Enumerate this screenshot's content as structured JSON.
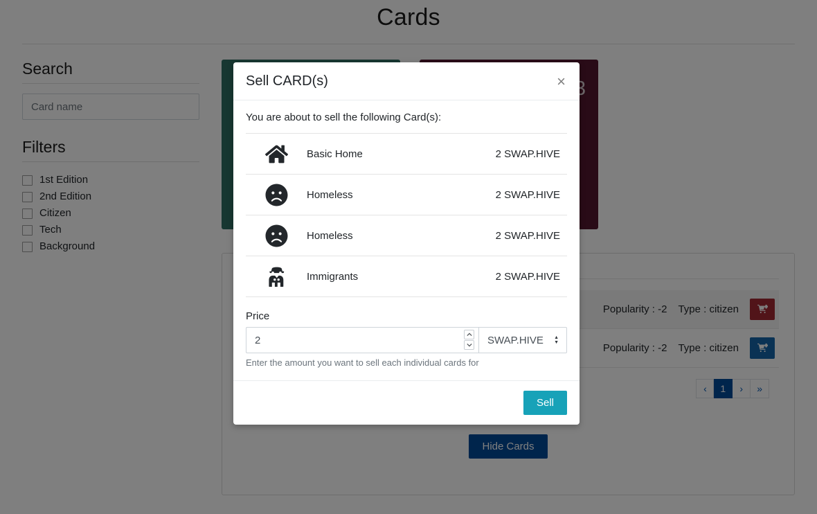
{
  "page": {
    "title": "Cards"
  },
  "sidebar": {
    "search_heading": "Search",
    "search_placeholder": "Card name",
    "search_value": "",
    "filters_heading": "Filters",
    "filters": [
      {
        "label": "1st Edition",
        "checked": false
      },
      {
        "label": "2nd Edition",
        "checked": false
      },
      {
        "label": "Citizen",
        "checked": false
      },
      {
        "label": "Tech",
        "checked": false
      },
      {
        "label": "Background",
        "checked": false
      }
    ]
  },
  "main": {
    "cards": [
      {
        "color": "#2e6e63",
        "corner_number": ""
      },
      {
        "color": "#52172f",
        "corner_number": "3"
      }
    ],
    "rows": [
      {
        "popularity_label": "Popularity : -2",
        "type_label": "Type : citizen",
        "cart_color": "#a32833",
        "cart_icon": "cart-plus-icon"
      },
      {
        "popularity_label": "Popularity : -2",
        "type_label": "Type : citizen",
        "cart_color": "#1565a8",
        "cart_icon": "cart-plus-icon"
      }
    ],
    "pagination": [
      {
        "label": "‹",
        "active": false,
        "name": "prev"
      },
      {
        "label": "1",
        "active": true,
        "name": "page-1"
      },
      {
        "label": "›",
        "active": false,
        "name": "next"
      },
      {
        "label": "»",
        "active": false,
        "name": "last"
      }
    ],
    "hide_cards_label": "Hide Cards"
  },
  "modal": {
    "title": "Sell CARD(s)",
    "close_label": "×",
    "lead": "You are about to sell the following Card(s):",
    "items": [
      {
        "icon": "home-icon",
        "name": "Basic Home",
        "price": "2 SWAP.HIVE"
      },
      {
        "icon": "frowning-face-icon",
        "name": "Homeless",
        "price": "2 SWAP.HIVE"
      },
      {
        "icon": "frowning-face-icon",
        "name": "Homeless",
        "price": "2 SWAP.HIVE"
      },
      {
        "icon": "spy-icon",
        "name": "Immigrants",
        "price": "2 SWAP.HIVE"
      }
    ],
    "price_label": "Price",
    "price_value": "2",
    "price_placeholder": "",
    "currency_selected": "SWAP.HIVE",
    "currency_options": [
      "SWAP.HIVE"
    ],
    "price_help": "Enter the amount you want to sell each individual cards for",
    "submit_label": "Sell"
  },
  "colors": {
    "accent_teal": "#17a2b8",
    "primary_blue": "#004a99",
    "card_teal": "#2e6e63",
    "card_maroon": "#52172f",
    "cart_red": "#a32833",
    "cart_blue": "#1565a8"
  }
}
